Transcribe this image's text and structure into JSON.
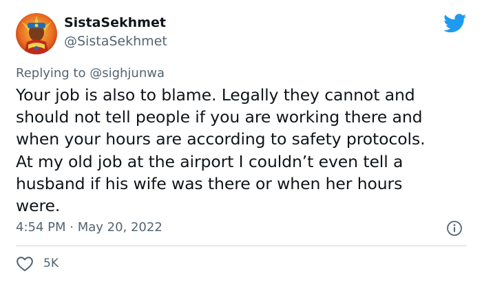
{
  "user": {
    "display_name": "SistaSekhmet",
    "handle": "@SistaSekhmet"
  },
  "reply": {
    "prefix": "Replying to ",
    "mention": "@sighjunwa"
  },
  "tweet": {
    "text": "Your job is also to blame. Legally they cannot and\nshould not tell people if you are working there and\nwhen your hours are according to safety protocols.\nAt my old job at the airport I couldn’t even tell a\nhusband if his wife was there or when her hours\nwere.",
    "timestamp": "4:54 PM · May 20, 2022",
    "likes": "5K"
  },
  "icons": {
    "brand": "twitter-bird-icon",
    "info": "info-icon",
    "like": "heart-icon"
  },
  "colors": {
    "brand": "#1d9bf0",
    "secondary_text": "#536471",
    "primary_text": "#0f1419",
    "divider": "#cfd9de"
  }
}
